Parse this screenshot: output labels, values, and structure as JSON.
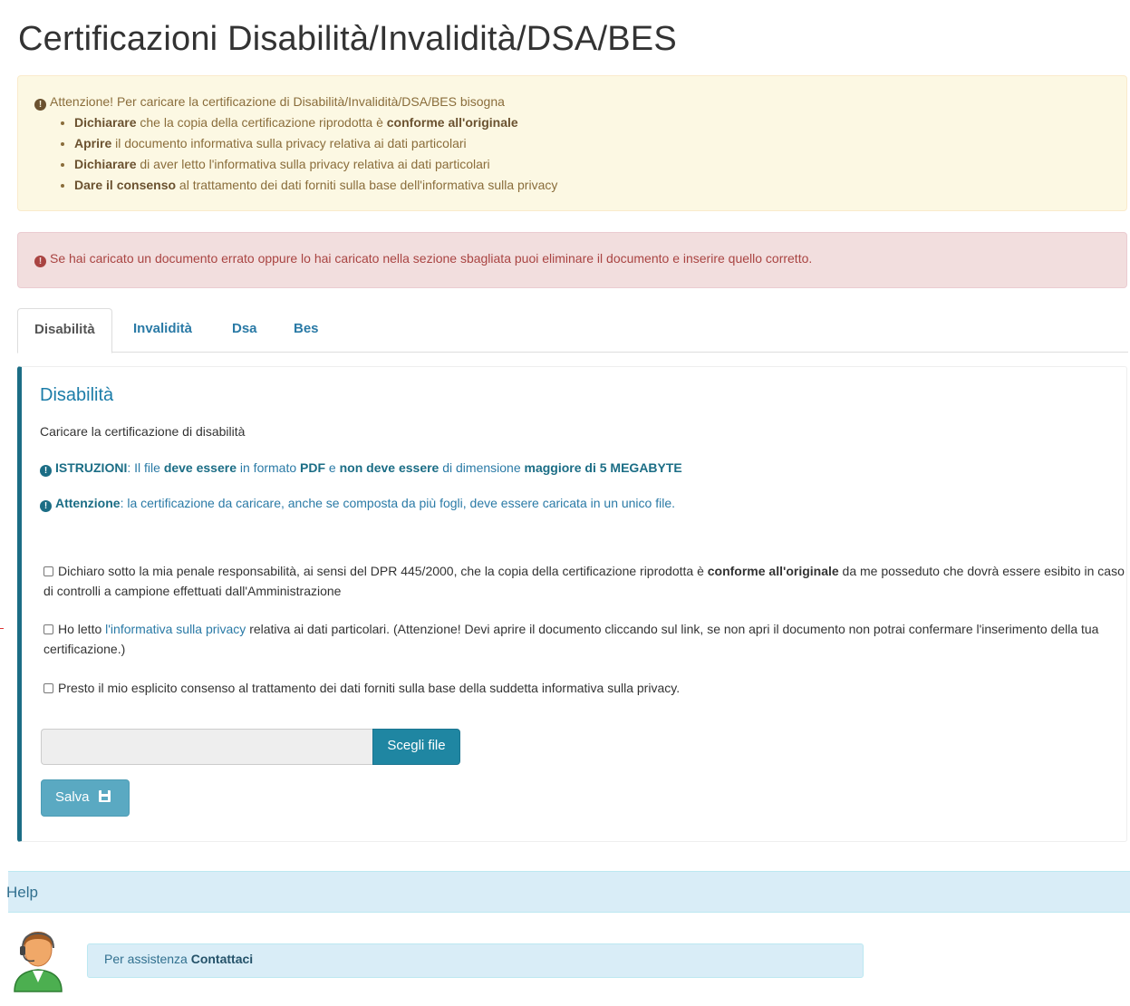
{
  "page": {
    "title": "Certificazioni Disabilità/Invalidità/DSA/BES"
  },
  "warning": {
    "lead": "Attenzione! Per caricare la certificazione di Disabilità/Invalidità/DSA/BES bisogna",
    "items": [
      {
        "strong": "Dichiarare",
        "text": " che la copia della certificazione riprodotta è ",
        "strong2": "conforme all'originale"
      },
      {
        "strong": "Aprire",
        "text": " il documento informativa sulla privacy relativa ai dati particolari"
      },
      {
        "strong": "Dichiarare",
        "text": " di aver letto l'informativa sulla privacy relativa ai dati particolari"
      },
      {
        "strong": "Dare il consenso",
        "text": " al trattamento dei dati forniti sulla base dell'informativa sulla privacy"
      }
    ]
  },
  "danger": {
    "text": "Se hai caricato un documento errato oppure lo hai caricato nella sezione sbagliata puoi eliminare il documento e inserire quello corretto."
  },
  "tabs": [
    {
      "label": "Disabilità",
      "active": true
    },
    {
      "label": "Invalidità"
    },
    {
      "label": "Dsa"
    },
    {
      "label": "Bes"
    }
  ],
  "panel": {
    "title": "Disabilità",
    "subtitle": "Caricare la certificazione di disabilità",
    "istruzioni": {
      "label": "ISTRUZIONI",
      "t1": ": Il file ",
      "s1": "deve essere",
      "t2": " in formato ",
      "s2": "PDF",
      "t3": " e ",
      "s3": "non deve essere",
      "t4": " di dimensione ",
      "s4": "maggiore di 5 MEGABYTE"
    },
    "attenzione": {
      "label": "Attenzione",
      "text": ": la certificazione da caricare, anche se composta da più fogli, deve essere caricata in un unico file."
    },
    "check1": {
      "pre": "Dichiaro sotto la mia penale responsabilità, ai sensi del DPR 445/2000, che la copia della certificazione riprodotta è ",
      "strong": "conforme all'originale",
      "post": " da me posseduto che dovrà essere esibito in caso di controlli a campione effettuati dall'Amministrazione"
    },
    "check2": {
      "pre": "Ho letto ",
      "link": "l'informativa sulla privacy",
      "post": " relativa ai dati particolari. (Attenzione! Devi aprire il documento cliccando sul link, se non apri il documento non potrai confermare l'inserimento della tua certificazione.)"
    },
    "check3": {
      "text": "Presto il mio esplicito consenso al trattamento dei dati forniti sulla base della suddetta informativa sulla privacy."
    },
    "file_button": "Scegli file",
    "save_button": "Salva"
  },
  "help": {
    "title": "Help",
    "assist_text": "Per assistenza ",
    "assist_link": "Contattaci"
  },
  "colors": {
    "accent": "#1b6d85",
    "link": "#2a7aa6",
    "warning_bg": "#fcf8e3",
    "danger_bg": "#f2dede",
    "info_bg": "#d9edf7"
  }
}
